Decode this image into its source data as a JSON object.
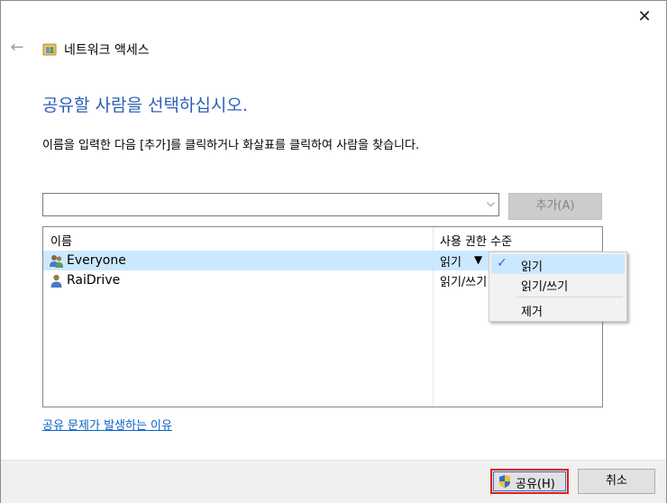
{
  "window": {
    "title": "네트워크 액세스"
  },
  "instruction": "공유할 사람을 선택하십시오.",
  "description": "이름을 입력한 다음 [추가]를 클릭하거나 화살표를 클릭하여 사람을 찾습니다.",
  "combo": {
    "value": "",
    "placeholder": ""
  },
  "add_button": "추가(A)",
  "list": {
    "columns": [
      "이름",
      "사용 권한 수준"
    ],
    "rows": [
      {
        "name": "Everyone",
        "permission": "읽기",
        "icon": "group-users-icon",
        "selected": true
      },
      {
        "name": "RaiDrive",
        "permission": "읽기/쓰기",
        "icon": "user-icon",
        "selected": false
      }
    ]
  },
  "permission_menu": {
    "items": [
      {
        "label": "읽기",
        "checked": true
      },
      {
        "label": "읽기/쓰기",
        "checked": false
      },
      {
        "label": "제거",
        "checked": false
      }
    ]
  },
  "help_link": "공유 문제가 발생하는 이유",
  "buttons": {
    "share": "공유(H)",
    "cancel": "취소"
  },
  "colors": {
    "accent": "#2b5fb3",
    "selection": "#cce8ff",
    "share_highlight": "#e02020"
  }
}
